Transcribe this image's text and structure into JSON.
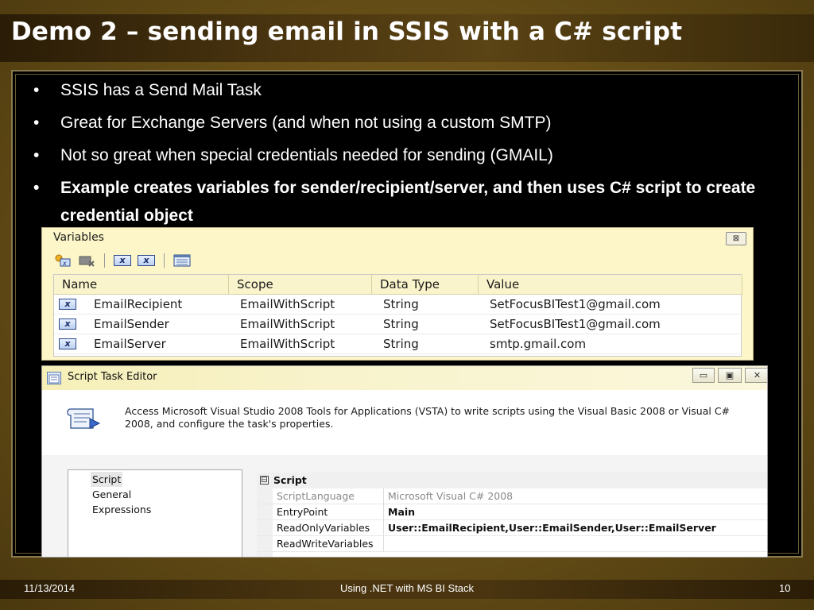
{
  "slide": {
    "title": "Demo 2 – sending email in SSIS with a C# script",
    "bullets": [
      {
        "dot": "•",
        "text": "SSIS has a Send Mail Task",
        "bold": false
      },
      {
        "dot": "•",
        "text": "Great for Exchange Servers (and when not using a custom SMTP)",
        "bold": false
      },
      {
        "dot": "•",
        "text": "Not so great when special credentials needed for sending (GMAIL)",
        "bold": false
      },
      {
        "dot": "•",
        "text": "Example creates variables for sender/recipient/server, and then uses C# script to create credential object",
        "bold": true
      }
    ]
  },
  "variables_window": {
    "title": "Variables",
    "close_glyph": "⊠",
    "toolbar_icons": [
      "add-variable-icon",
      "delete-variable-icon",
      "show-system-variables-icon",
      "show-all-variables-icon",
      "choose-columns-icon"
    ],
    "columns": [
      "Name",
      "Scope",
      "Data Type",
      "Value"
    ],
    "rows": [
      {
        "name": "EmailRecipient",
        "scope": "EmailWithScript",
        "type": "String",
        "value": "SetFocusBITest1@gmail.com"
      },
      {
        "name": "EmailSender",
        "scope": "EmailWithScript",
        "type": "String",
        "value": "SetFocusBITest1@gmail.com"
      },
      {
        "name": "EmailServer",
        "scope": "EmailWithScript",
        "type": "String",
        "value": "smtp.gmail.com"
      }
    ]
  },
  "script_editor": {
    "title": "Script Task Editor",
    "minimize_glyph": "▭",
    "restore_glyph": "▣",
    "close_glyph": "✕",
    "description": "Access Microsoft Visual Studio 2008 Tools for Applications (VSTA) to write scripts using the Visual Basic 2008 or Visual C# 2008, and configure the task's properties.",
    "nav_items": [
      "Script",
      "General",
      "Expressions"
    ],
    "selected_nav": "Script",
    "category": {
      "expander": "⊟",
      "label": "Script"
    },
    "properties": [
      {
        "name": "ScriptLanguage",
        "value": "Microsoft Visual C# 2008",
        "dim": true,
        "bold": false
      },
      {
        "name": "EntryPoint",
        "value": "Main",
        "dim": false,
        "bold": true
      },
      {
        "name": "ReadOnlyVariables",
        "value": "User::EmailRecipient,User::EmailSender,User::EmailServer",
        "dim": false,
        "bold": true
      },
      {
        "name": "ReadWriteVariables",
        "value": "",
        "dim": false,
        "bold": false
      }
    ]
  },
  "footer": {
    "date": "11/13/2014",
    "center": "Using .NET with MS BI Stack",
    "page": "10"
  },
  "colors": {
    "background": "#6b5218",
    "panel": "#000000",
    "window_yellow": "#fdf6c8"
  }
}
